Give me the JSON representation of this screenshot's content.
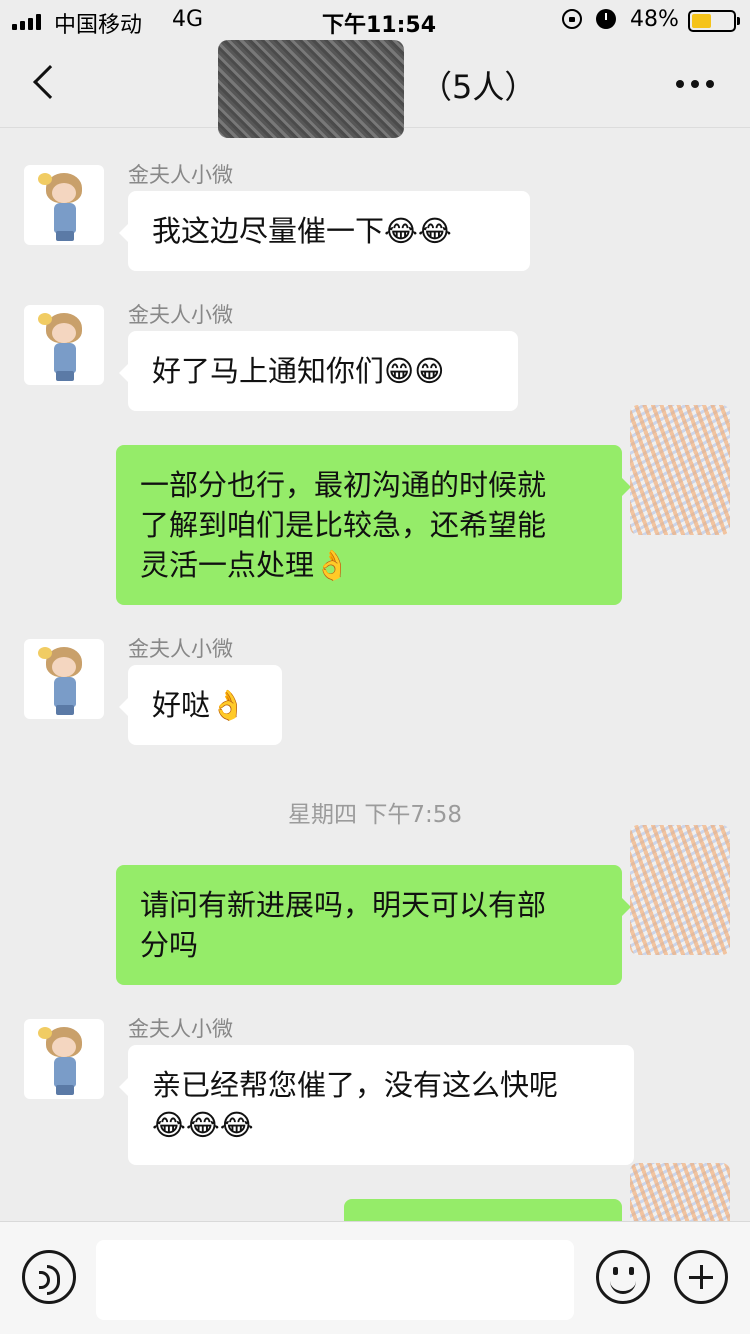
{
  "status_bar": {
    "carrier": "中国移动",
    "network": "4G",
    "time": "下午11:54",
    "battery_percent": "48%",
    "battery_level": 0.48,
    "icons": [
      "signal-icon",
      "lock-rotation-icon",
      "alarm-icon",
      "battery-icon"
    ]
  },
  "header": {
    "member_count": "（5人）",
    "icons": [
      "back-icon",
      "more-icon"
    ]
  },
  "messages": [
    {
      "direction": "in",
      "sender": "金夫人小微",
      "text": "我这边尽量催一下😂😂"
    },
    {
      "direction": "in",
      "sender": "金夫人小微",
      "text": "好了马上通知你们😁😁"
    },
    {
      "direction": "out",
      "lines": [
        "一部分也行，最初沟通的时候就",
        "了解到咱们是比较急，还希望能",
        "灵活一点处理👌"
      ]
    },
    {
      "direction": "in",
      "sender": "金夫人小微",
      "text": "好哒👌"
    },
    {
      "type": "timestamp",
      "text": "星期四 下午7:58"
    },
    {
      "direction": "out",
      "lines": [
        "请问有新进展吗，明天可以有部",
        "分吗"
      ]
    },
    {
      "direction": "in",
      "sender": "金夫人小微",
      "lines": [
        "亲已经帮您催了，没有这么快呢",
        "😂😂😂"
      ]
    }
  ],
  "input_bar": {
    "text_value": "",
    "icons": [
      "voice-icon",
      "emoji-icon",
      "add-icon"
    ]
  },
  "colors": {
    "background": "#ededed",
    "incoming_bubble": "#ffffff",
    "outgoing_bubble": "#95ec69",
    "sender_text": "#888888",
    "timestamp_text": "#9b9b9b"
  }
}
